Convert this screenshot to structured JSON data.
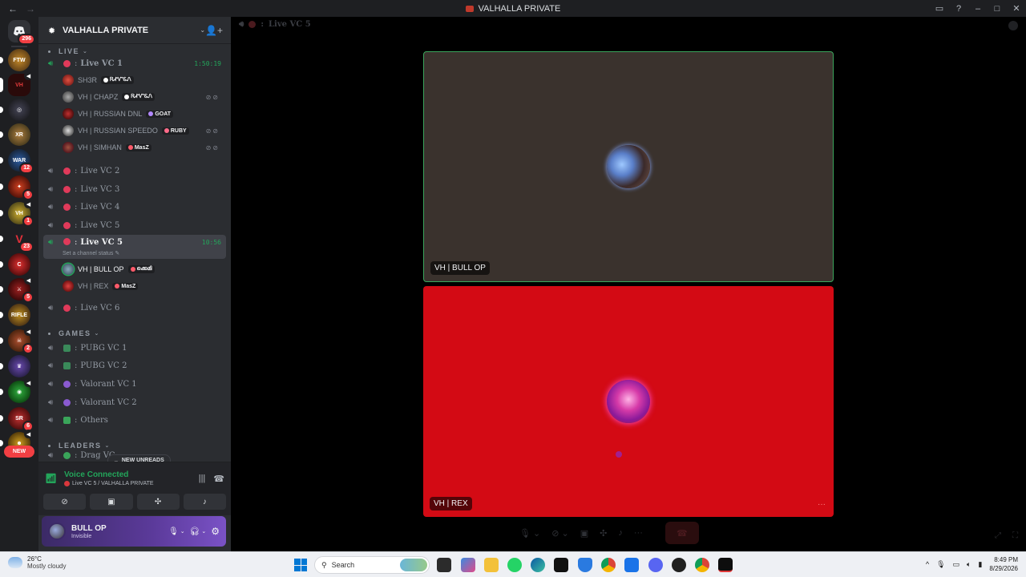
{
  "window": {
    "title": "VALHALLA PRIVATE"
  },
  "server_rail": {
    "home_badge": "296",
    "badges": [
      "12",
      "5",
      "1",
      "23",
      "5",
      "2",
      "6"
    ],
    "new_label": "NEW"
  },
  "server": {
    "name": "VALHALLA PRIVATE"
  },
  "categories": {
    "live": "LIVE",
    "games": "GAMES",
    "leaders": "LEADERS"
  },
  "channels": {
    "live_vc1": {
      "label": "Live VC 1",
      "time": "1:50:19"
    },
    "live_vc2": "Live VC 2",
    "live_vc3": "Live VC 3",
    "live_vc4": "Live VC 4",
    "live_vc5a": "Live VC 5",
    "live_vc5b": {
      "label": "Live VC 5",
      "time": "10:56",
      "status": "Set a channel status"
    },
    "live_vc6": "Live VC 6",
    "pubg1": "PUBG VC 1",
    "pubg2": "PUBG VC 2",
    "val1": "Valorant VC 1",
    "val2": "Valorant VC 2",
    "others": "Others",
    "drag": "Drag VC"
  },
  "members_vc1": [
    {
      "name": "SH3R",
      "tag": "ᏒᏗᏉᏋᏁ",
      "tag_color": "#ffffff"
    },
    {
      "name": "VH | CHAPZ",
      "tag": "ᏒᏗᏉᏋᏁ",
      "tag_color": "#ffffff"
    },
    {
      "name": "VH | RUSSIAN DNL",
      "tag": "GOAT",
      "tag_color": "#b388ff"
    },
    {
      "name": "VH | RUSSIAN SPEEDO",
      "tag": "RUBY",
      "tag_color": "#ff6b8a"
    },
    {
      "name": "VH | SIMHAN",
      "tag": "MasZ",
      "tag_color": "#ff5a6a"
    }
  ],
  "members_vc5": [
    {
      "name": "VH | BULL OP",
      "tag": "ക്കെമി",
      "tag_color": "#ff5a6a"
    },
    {
      "name": "VH | REX",
      "tag": "MasZ",
      "tag_color": "#ff5a6a"
    }
  ],
  "new_unreads": "NEW UNREADS",
  "voice": {
    "status": "Voice Connected",
    "channel": "Live VC 5 / VALHALLA PRIVATE"
  },
  "user": {
    "name": "BULL OP",
    "status": "Invisible"
  },
  "stage": {
    "header": "Live VC 5",
    "tiles": [
      {
        "name": "VH | BULL OP"
      },
      {
        "name": "VH | REX"
      }
    ]
  },
  "taskbar": {
    "weather_temp": "26°C",
    "weather_desc": "Mostly cloudy",
    "search_placeholder": "Search",
    "time": "8:49 PM",
    "date": "8/29/2026"
  },
  "colors": {
    "accent_green": "#23a55a",
    "danger": "#f23f43",
    "sidebar_bg": "#2b2d31",
    "rail_bg": "#1e1f22",
    "tile_red": "#d30a14"
  }
}
